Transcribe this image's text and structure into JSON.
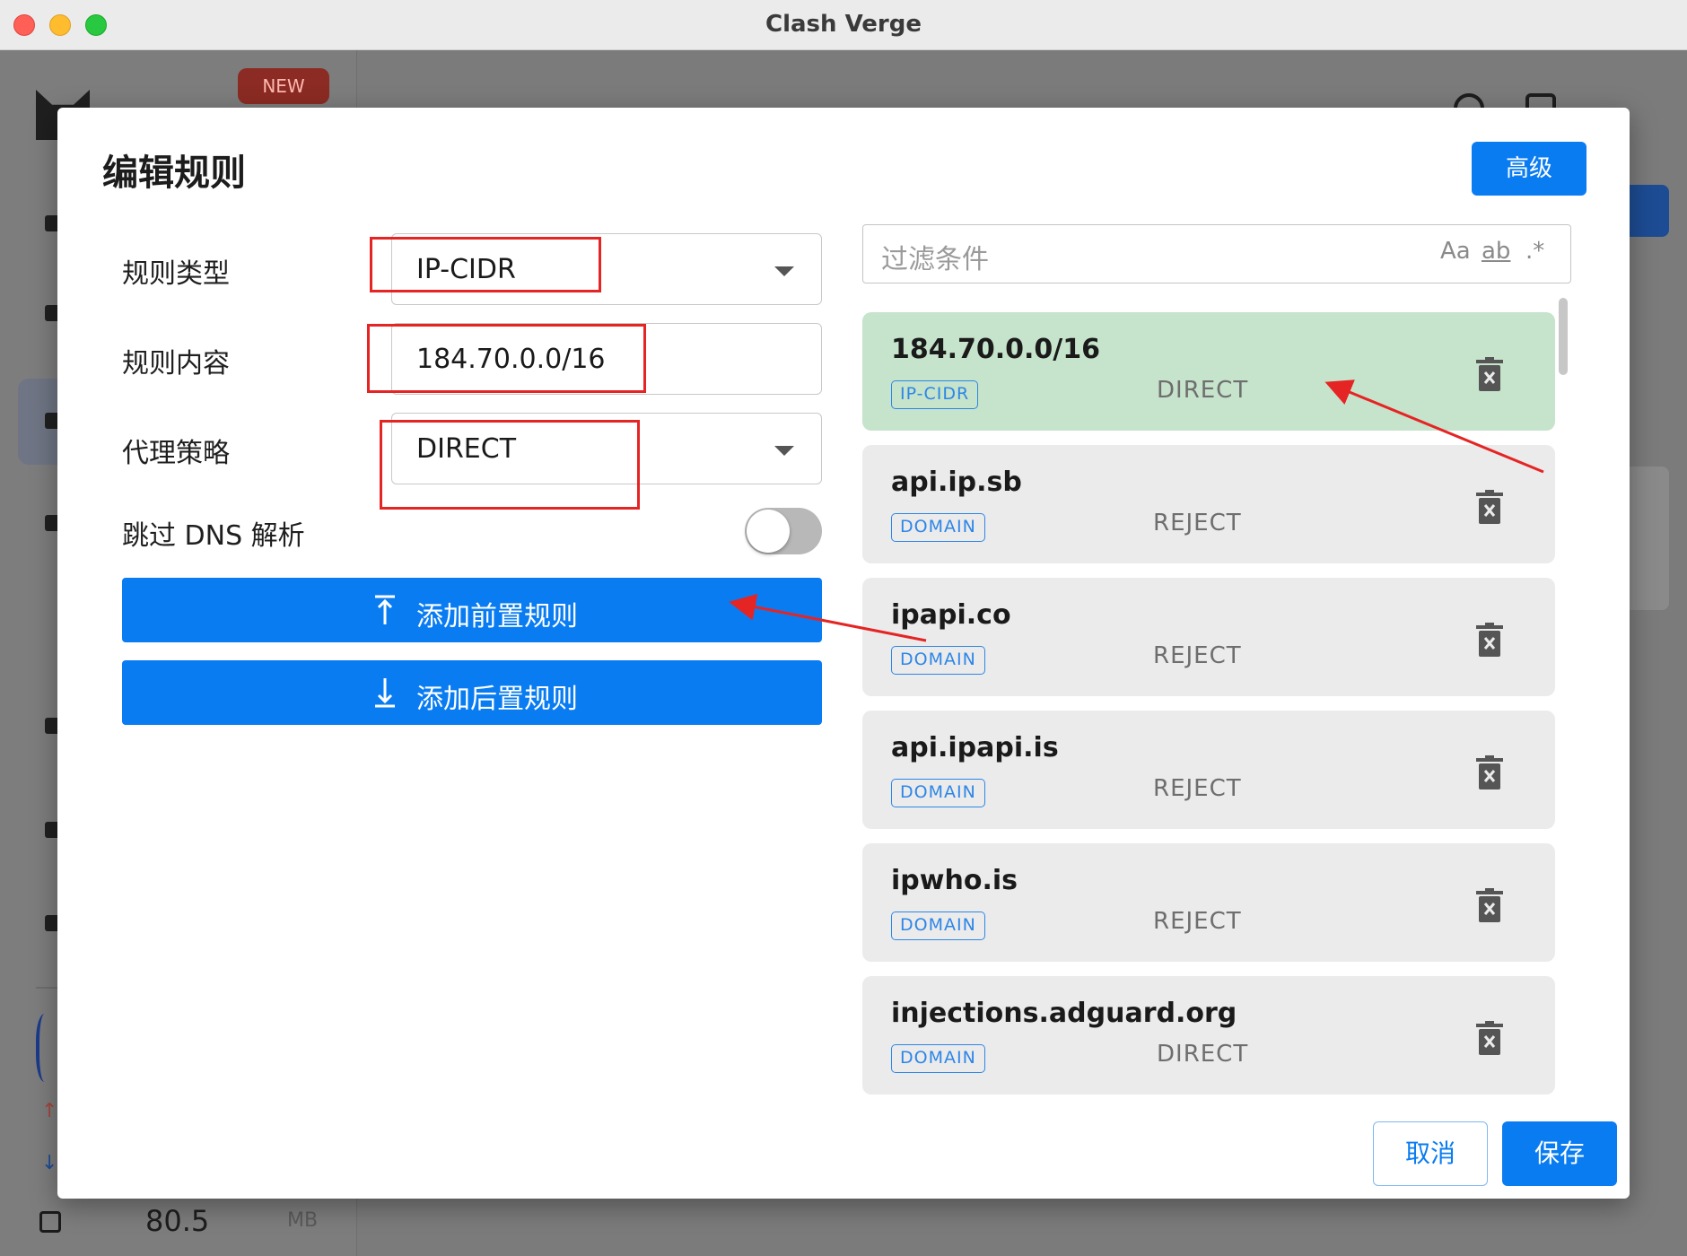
{
  "window": {
    "title": "Clash Verge"
  },
  "background": {
    "badge": "NEW",
    "memory_value": "80.5",
    "memory_unit": "MB"
  },
  "dialog": {
    "title": "编辑规则",
    "advanced_label": "高级",
    "form": {
      "rule_type_label": "规则类型",
      "rule_type_value": "IP-CIDR",
      "rule_content_label": "规则内容",
      "rule_content_value": "184.70.0.0/16",
      "proxy_policy_label": "代理策略",
      "proxy_policy_value": "DIRECT",
      "skip_dns_label": "跳过 DNS 解析",
      "skip_dns_enabled": false
    },
    "add_before_label": "添加前置规则",
    "add_after_label": "添加后置规则",
    "filter": {
      "placeholder": "过滤条件",
      "match_case": "Aa",
      "match_word": "ab",
      "regex": ".*"
    },
    "rules": [
      {
        "name": "184.70.0.0/16",
        "type": "IP-CIDR",
        "policy": "DIRECT",
        "highlighted": true
      },
      {
        "name": "api.ip.sb",
        "type": "DOMAIN",
        "policy": "REJECT",
        "highlighted": false
      },
      {
        "name": "ipapi.co",
        "type": "DOMAIN",
        "policy": "REJECT",
        "highlighted": false
      },
      {
        "name": "api.ipapi.is",
        "type": "DOMAIN",
        "policy": "REJECT",
        "highlighted": false
      },
      {
        "name": "ipwho.is",
        "type": "DOMAIN",
        "policy": "REJECT",
        "highlighted": false
      },
      {
        "name": "injections.adguard.org",
        "type": "DOMAIN",
        "policy": "DIRECT",
        "highlighted": false
      }
    ],
    "cancel_label": "取消",
    "save_label": "保存"
  },
  "colors": {
    "primary": "#0a7cf2",
    "highlight_row": "#c6e3cb",
    "annotation_red": "#e52424"
  }
}
